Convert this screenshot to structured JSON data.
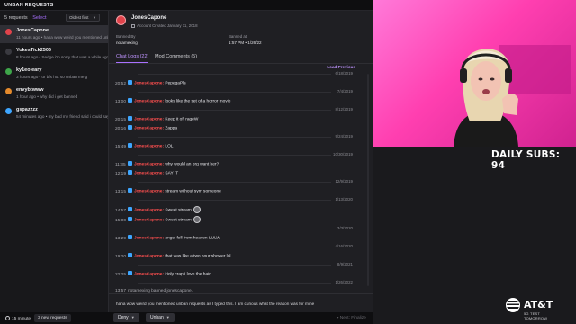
{
  "topbar": {
    "title": "UNBAN REQUESTS"
  },
  "requests": {
    "count_label": "5 requests",
    "select_label": "Select",
    "sort_value": "Oldest first",
    "items": [
      {
        "name": "JonesCapone",
        "meta": "11 hours ago • haha wow weird you mentioned unban re",
        "avatar_color": "#e0434b",
        "active": true
      },
      {
        "name": "YokesTick2506",
        "meta": "8 hours ago • Sedge i'm sorry that was a while ago",
        "avatar_color": "#3a3a40",
        "active": false
      },
      {
        "name": "ky1eoleary",
        "meta": "3 hours ago • ur bfs hot so unban me g",
        "avatar_color": "#3ea64a",
        "active": false
      },
      {
        "name": "envybtwww",
        "meta": "1 hour ago • why did i get banned",
        "avatar_color": "#e58a2c",
        "active": false
      },
      {
        "name": "gspazzzz",
        "meta": "54 minutes ago • my bad my friend said i could say it",
        "avatar_color": "#3ea6ff",
        "active": false
      }
    ]
  },
  "profile": {
    "name": "JonesCapone",
    "created": "Account Created January 11, 2018",
    "banned_by_label": "Banned By",
    "banned_by": "notamexing",
    "banned_at_label": "Banned at",
    "banned_at": "1:57 PM • 1/26/22"
  },
  "tabs": {
    "chat_logs": "Chat Logs (22)",
    "mod_comments": "Mod Comments (5)"
  },
  "load_previous": "Load Previous",
  "logs": [
    {
      "kind": "date",
      "text": "6/18/2019"
    },
    {
      "kind": "msg",
      "time": "20:52",
      "user": "JonesCapone:",
      "text": "PepegaPls"
    },
    {
      "kind": "date",
      "text": "7/4/2019"
    },
    {
      "kind": "msg",
      "time": "13:00",
      "user": "JonesCapone:",
      "text": "looks like the set of a horror movie"
    },
    {
      "kind": "date",
      "text": "8/12/2019"
    },
    {
      "kind": "msg",
      "time": "20:15",
      "user": "JonesCapone:",
      "text": "Keep it off rageW"
    },
    {
      "kind": "msg",
      "time": "20:16",
      "user": "JonesCapone:",
      "text": "Zappa"
    },
    {
      "kind": "date",
      "text": "9/24/2019"
    },
    {
      "kind": "msg",
      "time": "15:49",
      "user": "JonesCapone:",
      "text": "LOL"
    },
    {
      "kind": "date",
      "text": "10/30/2019"
    },
    {
      "kind": "msg",
      "time": "11:35",
      "user": "JonesCapone:",
      "text": "why would an org want her?"
    },
    {
      "kind": "msg",
      "time": "12:19",
      "user": "JonesCapone:",
      "text": "SAY IT"
    },
    {
      "kind": "date",
      "text": "12/9/2019"
    },
    {
      "kind": "msg",
      "time": "13:15",
      "user": "JonesCapone:",
      "text": "stream without sym someone"
    },
    {
      "kind": "date",
      "text": "1/13/2020"
    },
    {
      "kind": "msg",
      "time": "14:57",
      "user": "JonesCapone:",
      "text": "Sweet stream",
      "emote": true
    },
    {
      "kind": "msg",
      "time": "15:00",
      "user": "JonesCapone:",
      "text": "Sweet stream",
      "emote": true
    },
    {
      "kind": "date",
      "text": "3/3/2020"
    },
    {
      "kind": "msg",
      "time": "13:29",
      "user": "JonesCapone:",
      "text": "angel fell from heaven LULW"
    },
    {
      "kind": "date",
      "text": "4/16/2020"
    },
    {
      "kind": "msg",
      "time": "19:20",
      "user": "JonesCapone:",
      "text": "that was like a two hour shower lol"
    },
    {
      "kind": "date",
      "text": "8/9/2021"
    },
    {
      "kind": "msg",
      "time": "22:25",
      "user": "JonesCapone:",
      "text": "Holy crap I love the hair"
    },
    {
      "kind": "date",
      "text": "1/26/2022"
    },
    {
      "kind": "sys",
      "time": "13:57",
      "text": "notamexing banned jonescapone."
    }
  ],
  "request_message": "haha wow weird you mentioned unban requests as I typed this. I am curious what the reason was for mine",
  "bottombar": {
    "timer": "15 minute",
    "new_requests": "3 new requests",
    "deny": "Deny",
    "unban": "Unban",
    "next": "Next: Finalize"
  },
  "overlay": {
    "daily_subs": "DAILY SUBS: 94",
    "sponsor_word": "AT&T",
    "sponsor_sub": "5G TEST TOMORROW"
  }
}
